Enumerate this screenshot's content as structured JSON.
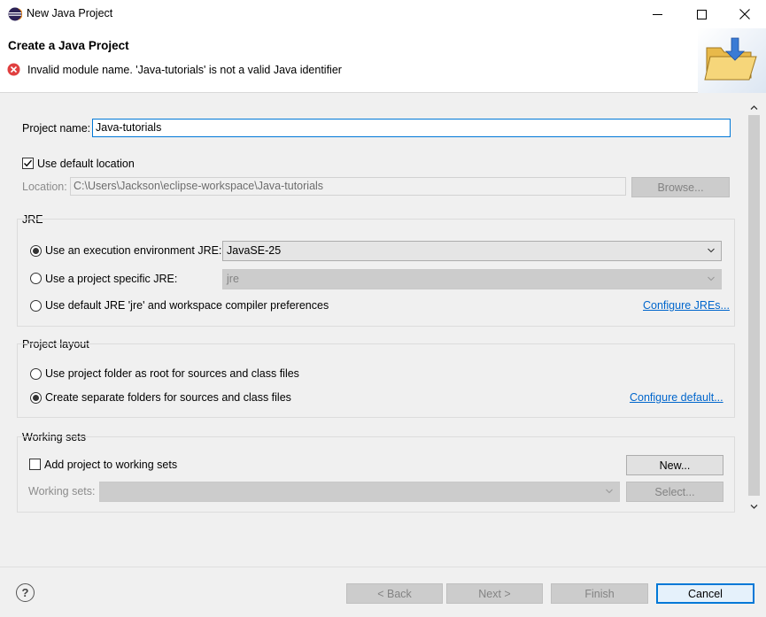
{
  "window": {
    "title": "New Java Project",
    "icon": "eclipse-icon"
  },
  "header": {
    "title": "Create a Java Project",
    "error_message": "Invalid module name. 'Java-tutorials' is not a valid Java identifier"
  },
  "project": {
    "name_label": "Project name:",
    "name_value": "Java-tutorials",
    "use_default_location_label": "Use default location",
    "use_default_location_checked": true,
    "location_label": "Location:",
    "location_value": "C:\\Users\\Jackson\\eclipse-workspace\\Java-tutorials",
    "browse_label": "Browse..."
  },
  "jre": {
    "group_title": "JRE",
    "option_env_label": "Use an execution environment JRE:",
    "option_env_value": "JavaSE-25",
    "option_specific_label": "Use a project specific JRE:",
    "option_specific_value": "jre",
    "option_default_label": "Use default JRE 'jre' and workspace compiler preferences",
    "configure_link": "Configure JREs...",
    "selected": "env"
  },
  "layout": {
    "group_title": "Project layout",
    "option_root_label": "Use project folder as root for sources and class files",
    "option_separate_label": "Create separate folders for sources and class files",
    "configure_link": "Configure default...",
    "selected": "separate"
  },
  "working_sets": {
    "group_title": "Working sets",
    "add_label": "Add project to working sets",
    "add_checked": false,
    "new_label": "New...",
    "sets_label": "Working sets:",
    "select_label": "Select..."
  },
  "buttons": {
    "help": "?",
    "back": "< Back",
    "next": "Next >",
    "finish": "Finish",
    "cancel": "Cancel"
  },
  "colors": {
    "error_red": "#e04040",
    "link_blue": "#0066cc",
    "focus_blue": "#0078d7",
    "content_bg": "#f0f0f0"
  }
}
